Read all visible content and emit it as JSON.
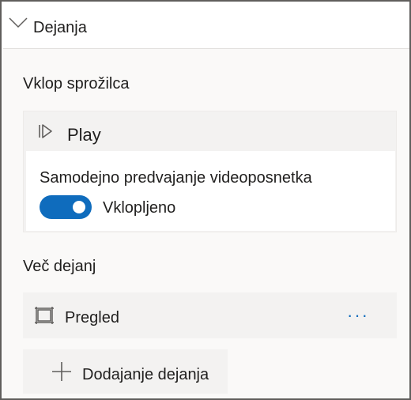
{
  "section": {
    "title": "Dejanja",
    "chevron_icon": "chevron-down-icon"
  },
  "trigger": {
    "label": "Vklop sprožilca",
    "card": {
      "icon": "play-icon",
      "title": "Play",
      "option_label": "Samodejno predvajanje videoposnetka",
      "toggle_state": "Vklopljeno",
      "toggle_on": true
    }
  },
  "more_actions": {
    "label": "Več dejanj",
    "items": [
      {
        "icon": "preview-icon",
        "label": "Pregled",
        "more_icon": "more-options-icon",
        "more_text": "···"
      }
    ]
  },
  "add_action": {
    "icon": "plus-icon",
    "label": "Dodajanje dejanja"
  },
  "colors": {
    "accent": "#0f6cbd",
    "panel_background": "#faf9f8",
    "card_background": "#f3f2f1",
    "text": "#201f1e"
  }
}
